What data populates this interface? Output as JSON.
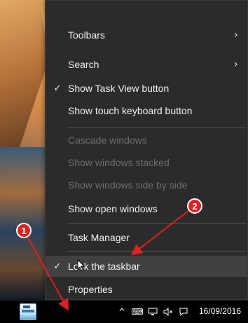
{
  "menu": {
    "items": [
      {
        "label": "Toolbars",
        "checked": false,
        "disabled": false,
        "submenu": true
      },
      {
        "label": "Search",
        "checked": false,
        "disabled": false,
        "submenu": true
      },
      {
        "label": "Show Task View button",
        "checked": true,
        "disabled": false,
        "submenu": false
      },
      {
        "label": "Show touch keyboard button",
        "checked": false,
        "disabled": false,
        "submenu": false
      },
      {
        "label": "Cascade windows",
        "checked": false,
        "disabled": true,
        "submenu": false
      },
      {
        "label": "Show windows stacked",
        "checked": false,
        "disabled": true,
        "submenu": false
      },
      {
        "label": "Show windows side by side",
        "checked": false,
        "disabled": true,
        "submenu": false
      },
      {
        "label": "Show open windows",
        "checked": false,
        "disabled": false,
        "submenu": false
      },
      {
        "label": "Task Manager",
        "checked": false,
        "disabled": false,
        "submenu": false
      },
      {
        "label": "Lock the taskbar",
        "checked": true,
        "disabled": false,
        "submenu": false,
        "hover": true
      },
      {
        "label": "Properties",
        "checked": false,
        "disabled": false,
        "submenu": false
      }
    ],
    "check_glyph": "✓",
    "chevron_glyph": "›"
  },
  "annotations": {
    "callout_1": "1",
    "callout_2": "2",
    "color": "#e02020"
  },
  "taskbar": {
    "date": "16/09/2016",
    "tray_icons": [
      "chevron-up-icon",
      "keyboard-icon",
      "network-icon",
      "volume-muted-icon",
      "action-center-icon"
    ],
    "tray_glyphs": [
      "^",
      "⌨",
      "🖵",
      "🔇",
      "⊖"
    ]
  }
}
